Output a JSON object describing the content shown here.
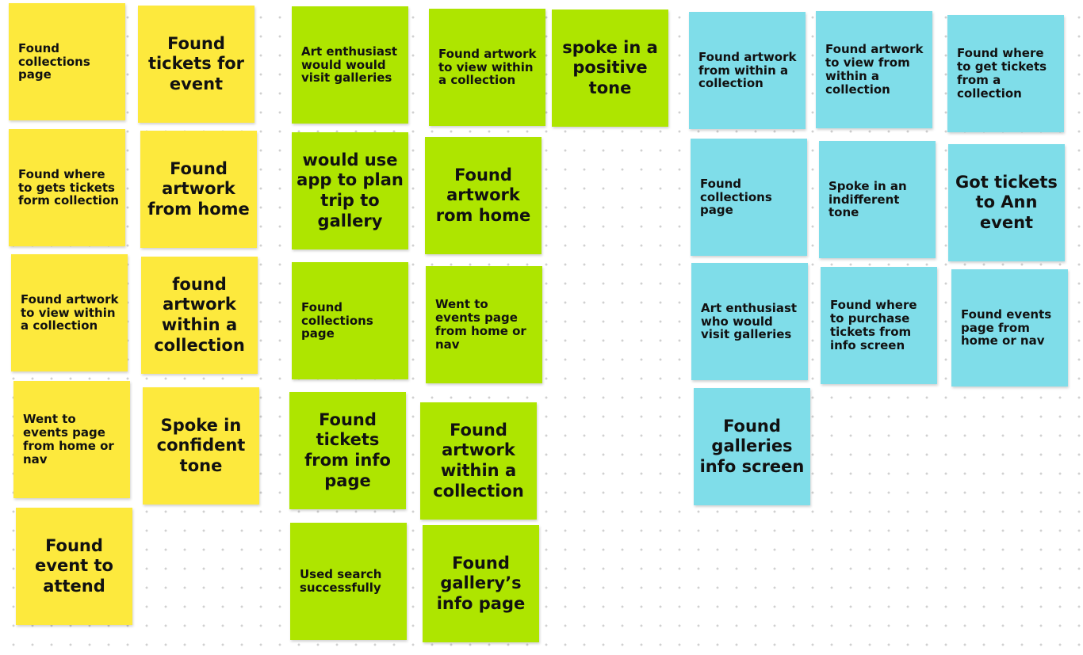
{
  "colors": {
    "yellow": "#fde93d",
    "green": "#aee500",
    "blue": "#7fdde9",
    "background": "#ffffff",
    "grid_dot": "#d0d0d0"
  },
  "notes": [
    {
      "id": "y1",
      "color": "yellow",
      "size": "sm",
      "text": "Found collections page"
    },
    {
      "id": "y2",
      "color": "yellow",
      "size": "lg",
      "text": "Found tickets for event"
    },
    {
      "id": "y3",
      "color": "yellow",
      "size": "sm",
      "text": "Found where to gets tickets form collection"
    },
    {
      "id": "y4",
      "color": "yellow",
      "size": "lg",
      "text": "Found artwork from home"
    },
    {
      "id": "y5",
      "color": "yellow",
      "size": "sm",
      "text": "Found artwork to view within a collection"
    },
    {
      "id": "y6",
      "color": "yellow",
      "size": "lg",
      "text": "found artwork within a collection"
    },
    {
      "id": "y7",
      "color": "yellow",
      "size": "sm",
      "text": "Went to events page from home or nav"
    },
    {
      "id": "y8",
      "color": "yellow",
      "size": "lg",
      "text": "Spoke in confident tone"
    },
    {
      "id": "y9",
      "color": "yellow",
      "size": "lg",
      "text": "Found event to attend"
    },
    {
      "id": "g1",
      "color": "green",
      "size": "sm",
      "text": "Art enthusiast would would visit galleries"
    },
    {
      "id": "g2",
      "color": "green",
      "size": "sm",
      "text": "Found artwork to view within a collection"
    },
    {
      "id": "g3",
      "color": "green",
      "size": "lg",
      "text": "spoke in a positive tone"
    },
    {
      "id": "g4",
      "color": "green",
      "size": "lg",
      "text": "would use app to plan trip to gallery"
    },
    {
      "id": "g5",
      "color": "green",
      "size": "lg",
      "text": "Found artwork rom home"
    },
    {
      "id": "g6",
      "color": "green",
      "size": "sm",
      "text": "Found collections page"
    },
    {
      "id": "g7",
      "color": "green",
      "size": "sm",
      "text": "Went to events page from home or nav"
    },
    {
      "id": "g8",
      "color": "green",
      "size": "lg",
      "text": "Found tickets from info page"
    },
    {
      "id": "g9",
      "color": "green",
      "size": "lg",
      "text": "Found artwork within a collection"
    },
    {
      "id": "g10",
      "color": "green",
      "size": "sm",
      "text": "Used search successfully"
    },
    {
      "id": "g11",
      "color": "green",
      "size": "lg",
      "text": "Found gallery’s info page"
    },
    {
      "id": "b1",
      "color": "blue",
      "size": "sm",
      "text": "Found artwork from within a collection"
    },
    {
      "id": "b2",
      "color": "blue",
      "size": "sm",
      "text": "Found artwork to view from within a collection"
    },
    {
      "id": "b3",
      "color": "blue",
      "size": "sm",
      "text": "Found where to get tickets from a collection"
    },
    {
      "id": "b4",
      "color": "blue",
      "size": "sm",
      "text": "Found collections page"
    },
    {
      "id": "b5",
      "color": "blue",
      "size": "sm",
      "text": "Spoke in an indifferent tone"
    },
    {
      "id": "b6",
      "color": "blue",
      "size": "lg",
      "text": "Got tickets to Ann event"
    },
    {
      "id": "b7",
      "color": "blue",
      "size": "sm",
      "text": "Art enthusiast who would visit galleries"
    },
    {
      "id": "b8",
      "color": "blue",
      "size": "sm",
      "text": "Found where to purchase tickets from info screen"
    },
    {
      "id": "b9",
      "color": "blue",
      "size": "sm",
      "text": "Found events page from home or nav"
    },
    {
      "id": "b10",
      "color": "blue",
      "size": "lg",
      "text": "Found galleries info screen"
    }
  ]
}
